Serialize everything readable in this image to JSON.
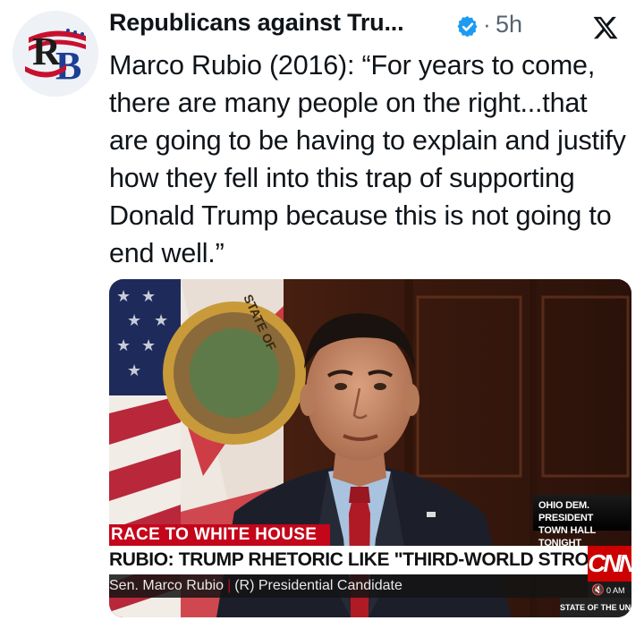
{
  "post": {
    "author_name": "Republicans against Tru...",
    "separator": "·",
    "time": "5h",
    "avatar_text": "RB",
    "text": "Marco Rubio (2016): “For years to come, there are many people on the right...that are going to be having to explain and justify how they fell into this trap of supporting Donald Trump because this is not going to end well.”"
  },
  "icons": {
    "verified": "verified-badge-icon",
    "close": "x-logo-icon",
    "mute": "mute-icon",
    "verified_color": "#1d9bf0"
  },
  "video": {
    "corner_chyron_line1": "OHIO DEM. PRESIDENT",
    "corner_chyron_line2": "TOWN HALL TONIGHT",
    "section_banner": "RACE TO WHITE HOUSE",
    "headline": "RUBIO: TRUMP RHETORIC LIKE \"THIRD-WORLD STRONG MEN\"",
    "name_line": "Sen. Marco Rubio",
    "title_line": "(R) Presidential Candidate",
    "network_logo": "CNN",
    "clock_text": "0 AM",
    "program": "STATE OF THE UNION",
    "seal_text": "STATE OF FLORIDA",
    "accent_color": "#c4061b"
  }
}
